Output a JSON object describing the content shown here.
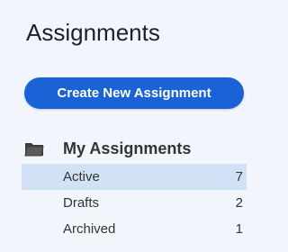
{
  "page": {
    "title": "Assignments"
  },
  "actions": {
    "create_label": "Create New Assignment"
  },
  "section": {
    "label": "My Assignments",
    "icon": "folder-icon"
  },
  "items": [
    {
      "label": "Active",
      "count": "7",
      "selected": true
    },
    {
      "label": "Drafts",
      "count": "2",
      "selected": false
    },
    {
      "label": "Archived",
      "count": "1",
      "selected": false
    }
  ],
  "colors": {
    "background": "#f2f5fc",
    "accent": "#1a63d6",
    "selected_row": "#d2e2f6"
  }
}
